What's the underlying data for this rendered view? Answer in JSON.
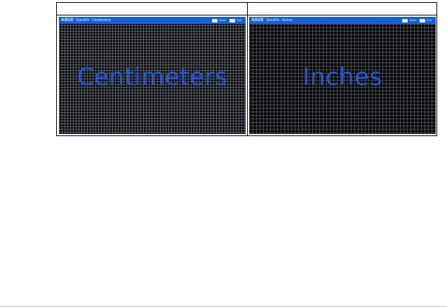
{
  "table": {
    "header": {
      "left": "",
      "right": ""
    },
    "left": {
      "brand": "ASUS",
      "window_title": "QuickFit - Centimeters",
      "menu_label": "Menu",
      "exit_label": "Exit",
      "unit_label": "Centimeters"
    },
    "right": {
      "brand": "ASUS",
      "window_title": "QuickFit - Inches",
      "menu_label": "Menu",
      "exit_label": "Exit",
      "unit_label": "Inches"
    }
  },
  "colors": {
    "title_bar": "#1560d8",
    "unit_text": "#1f57d6",
    "screen_bg": "#0d0d0d"
  }
}
